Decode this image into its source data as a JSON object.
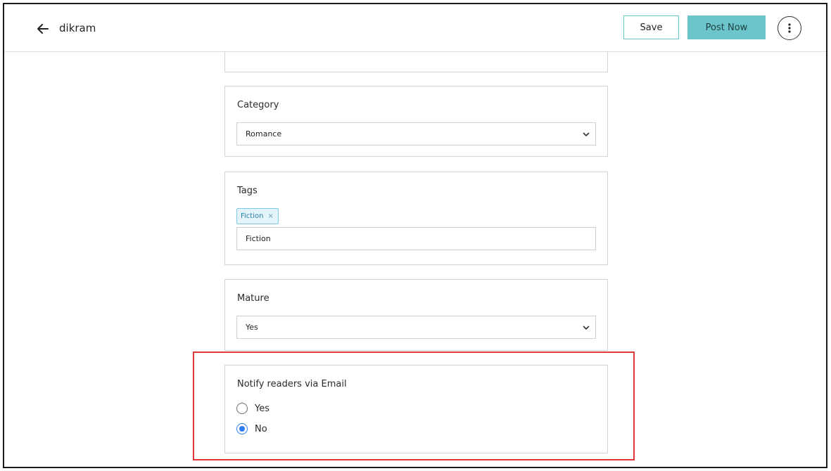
{
  "header": {
    "story_title": "dikram",
    "save_label": "Save",
    "post_label": "Post Now"
  },
  "category": {
    "label": "Category",
    "selected": "Romance"
  },
  "tags": {
    "label": "Tags",
    "chips": [
      "Fiction"
    ],
    "remove_glyph": "×",
    "input_value": "Fiction"
  },
  "mature": {
    "label": "Mature",
    "selected": "Yes"
  },
  "notify": {
    "label": "Notify readers via Email",
    "options": [
      {
        "label": "Yes",
        "checked": false
      },
      {
        "label": "No",
        "checked": true
      }
    ]
  },
  "colors": {
    "accent": "#6cc5ca",
    "radio_checked": "#2f7cf6",
    "highlight": "#e23a3a",
    "tag_bg": "#e3f4fb"
  },
  "icons": [
    "arrow-left-icon",
    "more-vertical-icon",
    "chevron-down-icon"
  ]
}
